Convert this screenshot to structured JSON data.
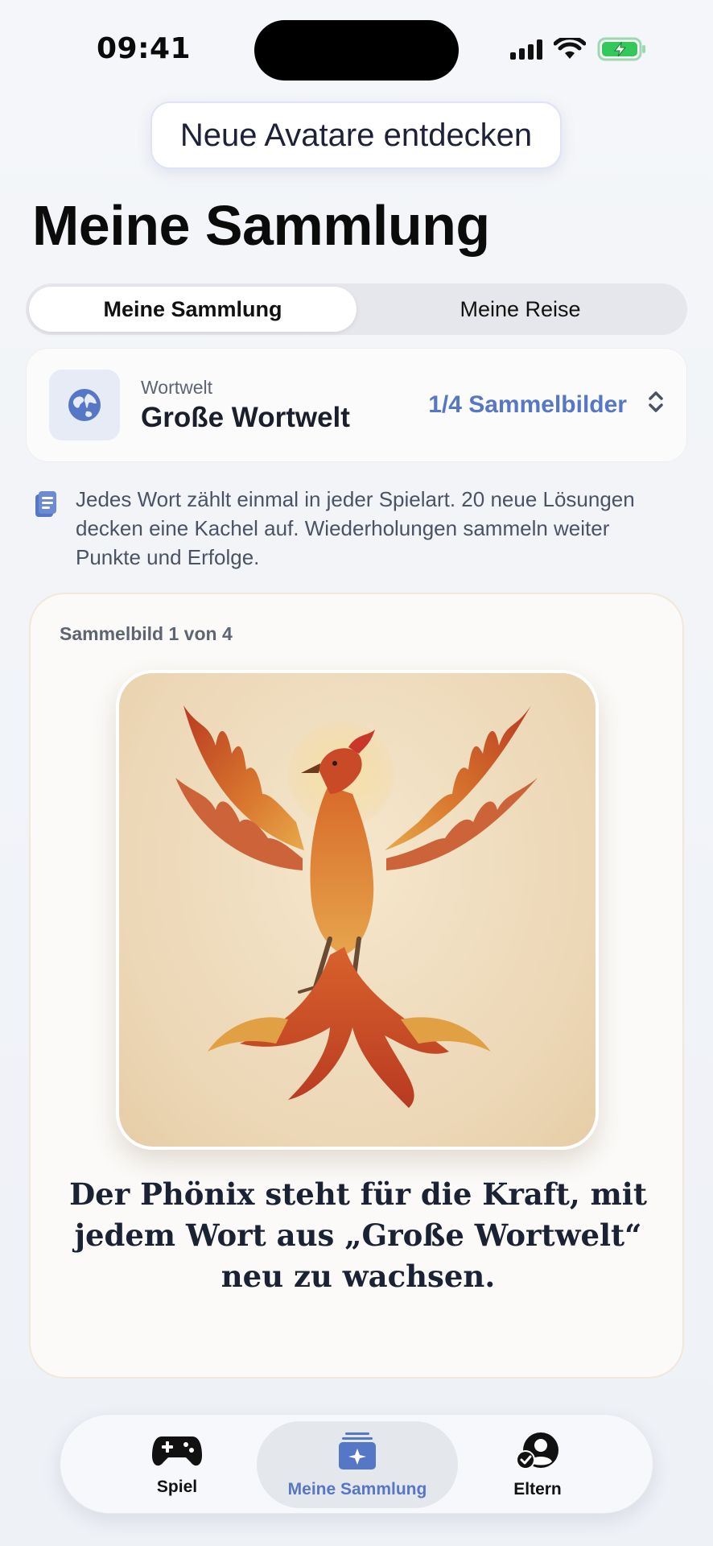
{
  "status": {
    "time": "09:41"
  },
  "banner": {
    "label": "Neue Avatare entdecken"
  },
  "page": {
    "title": "Meine Sammlung"
  },
  "segments": [
    {
      "label": "Meine Sammlung",
      "active": true
    },
    {
      "label": "Meine Reise",
      "active": false
    }
  ],
  "world": {
    "label": "Wortwelt",
    "name": "Große Wortwelt",
    "count": "1/4 Sammelbilder",
    "icon": "globe-icon"
  },
  "info": {
    "text": "Jedes Wort zählt einmal in jeder Spielart. 20 neue Lösungen decken eine Kachel auf. Wiederholungen sammeln weiter Punkte und Erfolge.",
    "icon": "document-icon"
  },
  "collectible": {
    "caption": "Sammelbild 1 von 4",
    "image": "phoenix",
    "quote": "Der Phönix steht für die Kraft, mit jedem Wort aus „Große Wortwelt“ neu zu wachsen."
  },
  "tabbar": {
    "items": [
      {
        "label": "Spiel",
        "icon": "gamepad-icon"
      },
      {
        "label": "Meine Sammlung",
        "icon": "collection-icon",
        "active": true
      },
      {
        "label": "Eltern",
        "icon": "parent-profile-icon"
      }
    ]
  },
  "colors": {
    "accent": "#5577c5",
    "battery": "#34c759"
  }
}
